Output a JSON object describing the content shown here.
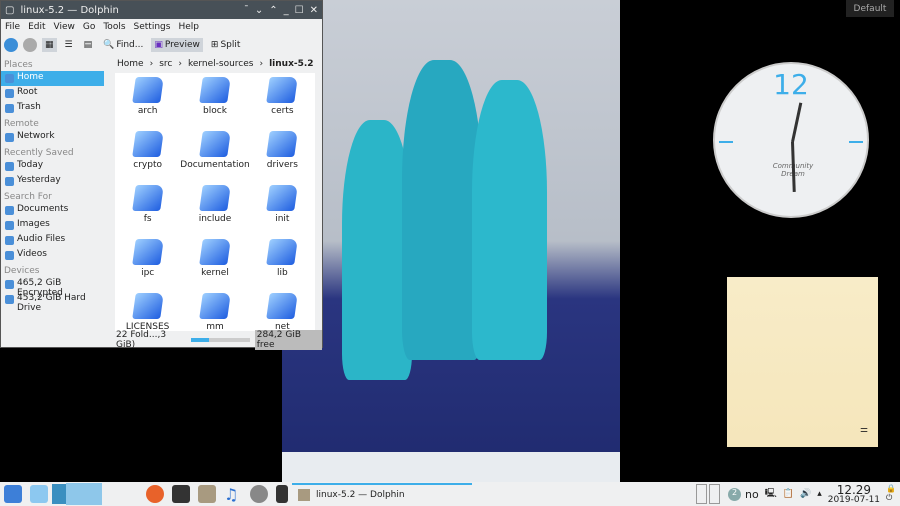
{
  "window": {
    "title": "linux-5.2 — Dolphin",
    "menu": [
      "File",
      "Edit",
      "View",
      "Go",
      "Tools",
      "Settings",
      "Help"
    ],
    "toolbar": {
      "find": "Find...",
      "preview": "Preview",
      "split": "Split"
    }
  },
  "places": [
    {
      "header": "Places",
      "items": [
        "Home",
        "Root",
        "Trash"
      ]
    },
    {
      "header": "Remote",
      "items": [
        "Network"
      ]
    },
    {
      "header": "Recently Saved",
      "items": [
        "Today",
        "Yesterday"
      ]
    },
    {
      "header": "Search For",
      "items": [
        "Documents",
        "Images",
        "Audio Files",
        "Videos"
      ]
    },
    {
      "header": "Devices",
      "items": [
        "465,2 GiB Encrypted",
        "453,2 GiB Hard Drive"
      ]
    }
  ],
  "breadcrumb": [
    "Home",
    "src",
    "kernel-sources",
    "linux-5.2"
  ],
  "files": [
    "arch",
    "block",
    "certs",
    "crypto",
    "Documentation",
    "drivers",
    "fs",
    "include",
    "init",
    "ipc",
    "kernel",
    "lib",
    "LICENSES",
    "mm",
    "net"
  ],
  "status": {
    "summary": "22 Fold...,3 GiB)",
    "free": "284,2 GiB free",
    "zoom_fraction": 0.3
  },
  "desktop": {
    "default_label": "Default",
    "clock_number": "12",
    "clock_brand": "Community Dream"
  },
  "taskbar": {
    "task": "linux-5.2 — Dolphin",
    "badge": "2",
    "layout": "no",
    "time": "12.29",
    "date": "2019-07-11"
  }
}
